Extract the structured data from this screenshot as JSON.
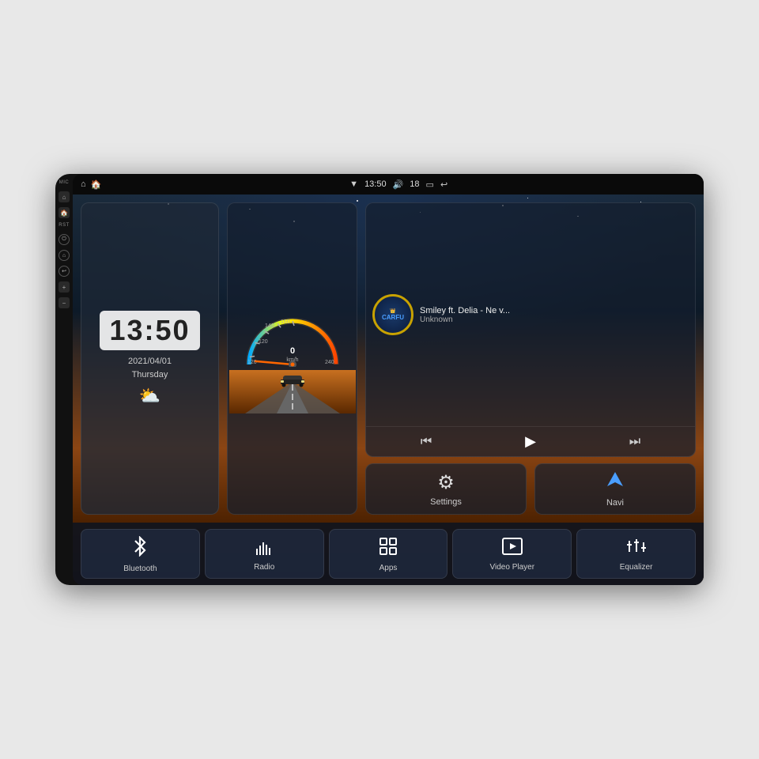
{
  "device": {
    "background": "#e8e8e8"
  },
  "status_bar": {
    "left_icons": [
      "🏠",
      "⌂"
    ],
    "time": "13:50",
    "signal_icon": "▼",
    "volume_icon": "🔊",
    "volume_level": "18",
    "window_icon": "⬜",
    "back_icon": "↩"
  },
  "side_buttons": {
    "mic_label": "MIC",
    "rst_label": "RST",
    "buttons": [
      "⏻",
      "⌂",
      "↩",
      "vol_up",
      "vol_down"
    ]
  },
  "clock_widget": {
    "time": "13:50",
    "date": "2021/04/01",
    "day": "Thursday",
    "weather": "⛅"
  },
  "music_widget": {
    "title": "Smiley ft. Delia - Ne v...",
    "artist": "Unknown",
    "album_text": "CARFU"
  },
  "music_controls": {
    "prev": "⏮",
    "play": "▶",
    "next": "⏭"
  },
  "settings_buttons": [
    {
      "id": "settings",
      "label": "Settings",
      "icon": "⚙"
    },
    {
      "id": "navi",
      "label": "Navi",
      "icon": "▲"
    }
  ],
  "app_buttons": [
    {
      "id": "bluetooth",
      "label": "Bluetooth",
      "icon": "bluetooth"
    },
    {
      "id": "radio",
      "label": "Radio",
      "icon": "radio"
    },
    {
      "id": "apps",
      "label": "Apps",
      "icon": "apps"
    },
    {
      "id": "video_player",
      "label": "Video Player",
      "icon": "video"
    },
    {
      "id": "equalizer",
      "label": "Equalizer",
      "icon": "equalizer"
    }
  ],
  "speedometer": {
    "speed": "0",
    "unit": "km/h",
    "max": "240"
  }
}
